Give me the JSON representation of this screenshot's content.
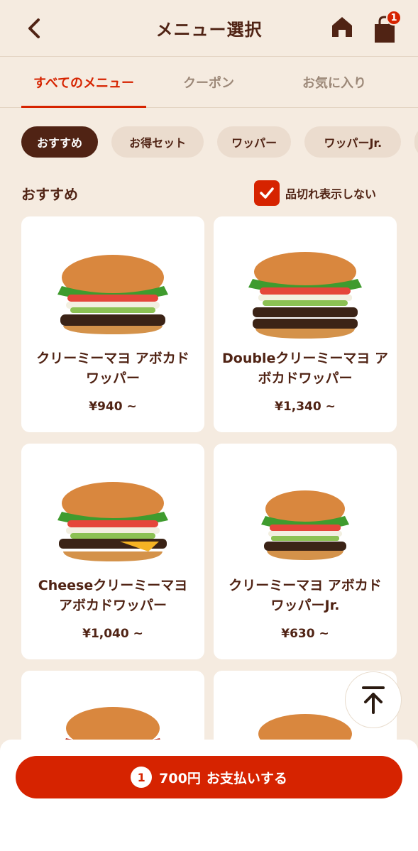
{
  "header": {
    "title": "メニュー選択",
    "cart_count": "1"
  },
  "tabs": [
    {
      "label": "すべてのメニュー",
      "active": true
    },
    {
      "label": "クーポン",
      "active": false
    },
    {
      "label": "お気に入り",
      "active": false
    }
  ],
  "chips": [
    {
      "label": "おすすめ",
      "active": true
    },
    {
      "label": "お得セット",
      "active": false
    },
    {
      "label": "ワッパー",
      "active": false
    },
    {
      "label": "ワッパーJr.",
      "active": false
    }
  ],
  "section": {
    "title": "おすすめ",
    "soldout_label": "品切れ表示しない",
    "soldout_checked": true
  },
  "products": [
    {
      "name": "クリーミーマヨ アボカドワッパー",
      "price": "¥940 ~"
    },
    {
      "name": "Doubleクリーミーマヨ アボカドワッパー",
      "price": "¥1,340 ~"
    },
    {
      "name": "Cheeseクリーミーマヨ アボカドワッパー",
      "price": "¥1,040 ~"
    },
    {
      "name": "クリーミーマヨ アボカドワッパーJr.",
      "price": "¥630 ~"
    }
  ],
  "checkout": {
    "count": "1",
    "amount": "700円",
    "label": "お支払いする"
  },
  "colors": {
    "background": "#f5ebe0",
    "brand_red": "#d62300",
    "brown": "#502314"
  }
}
